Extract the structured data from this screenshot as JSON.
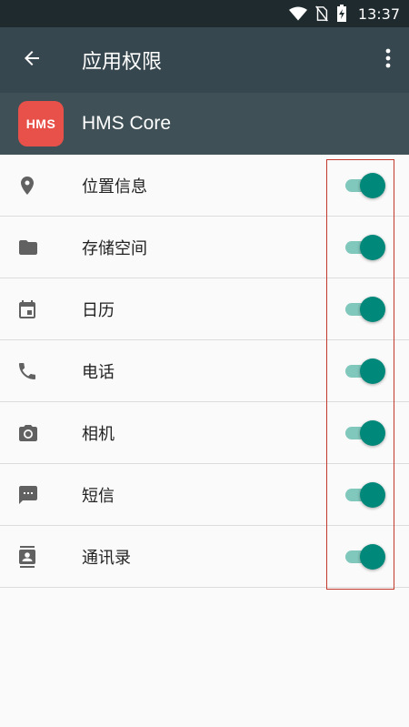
{
  "status_bar": {
    "time": "13:37",
    "icons": [
      "wifi-icon",
      "no-sim-icon",
      "battery-charging-icon"
    ]
  },
  "toolbar": {
    "back_icon": "arrow-back-icon",
    "title": "应用权限",
    "menu_icon": "more-vert-icon"
  },
  "app": {
    "icon_text": "HMS",
    "name": "HMS Core",
    "icon_color": "#e8504a"
  },
  "permissions": [
    {
      "label": "位置信息",
      "icon": "location-pin-icon",
      "enabled": true
    },
    {
      "label": "存储空间",
      "icon": "folder-icon",
      "enabled": true
    },
    {
      "label": "日历",
      "icon": "calendar-icon",
      "enabled": true
    },
    {
      "label": "电话",
      "icon": "phone-icon",
      "enabled": true
    },
    {
      "label": "相机",
      "icon": "camera-icon",
      "enabled": true
    },
    {
      "label": "短信",
      "icon": "sms-icon",
      "enabled": true
    },
    {
      "label": "通讯录",
      "icon": "contacts-icon",
      "enabled": true
    }
  ],
  "colors": {
    "accent": "#00897b",
    "toolbar": "#37474f",
    "highlight": "#c0392b"
  }
}
